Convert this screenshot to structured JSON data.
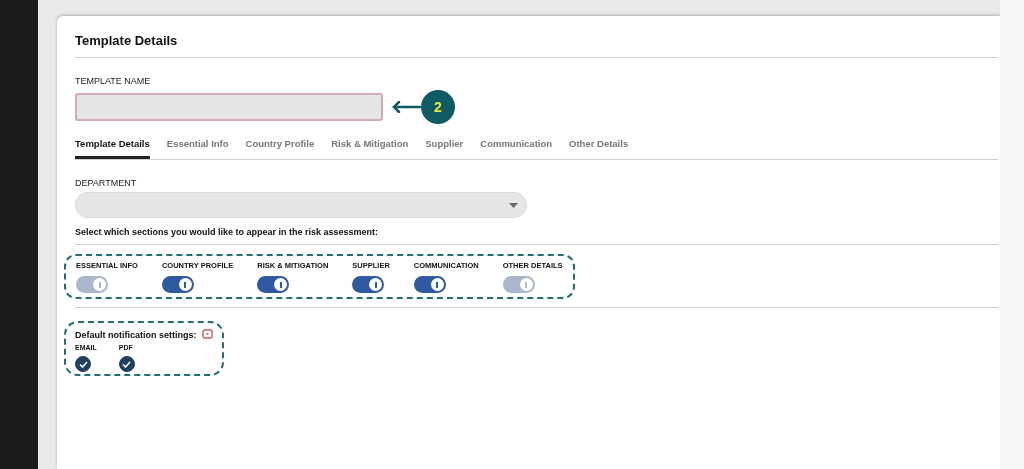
{
  "card": {
    "title": "Template Details"
  },
  "template_name": {
    "label": "TEMPLATE NAME"
  },
  "annotation": {
    "number": "2"
  },
  "tabs": [
    {
      "label": "Template Details",
      "selected": true
    },
    {
      "label": "Essential Info",
      "selected": false
    },
    {
      "label": "Country Profile",
      "selected": false
    },
    {
      "label": "Risk & Mitigation",
      "selected": false
    },
    {
      "label": "Supplier",
      "selected": false
    },
    {
      "label": "Communication",
      "selected": false
    },
    {
      "label": "Other Details",
      "selected": false
    }
  ],
  "department": {
    "label": "DEPARTMENT"
  },
  "sections_prompt": "Select which sections you would like to appear in the risk assessment:",
  "sections": [
    {
      "label": "ESSENTIAL INFO",
      "on": true,
      "disabled": true
    },
    {
      "label": "COUNTRY PROFILE",
      "on": true,
      "disabled": false
    },
    {
      "label": "RISK & MITIGATION",
      "on": true,
      "disabled": false
    },
    {
      "label": "SUPPLIER",
      "on": true,
      "disabled": false
    },
    {
      "label": "COMMUNICATION",
      "on": true,
      "disabled": false
    },
    {
      "label": "OTHER DETAILS",
      "on": true,
      "disabled": true
    }
  ],
  "notifications": {
    "title": "Default notification settings:",
    "options": [
      {
        "label": "EMAIL",
        "checked": true
      },
      {
        "label": "PDF",
        "checked": true
      }
    ]
  }
}
